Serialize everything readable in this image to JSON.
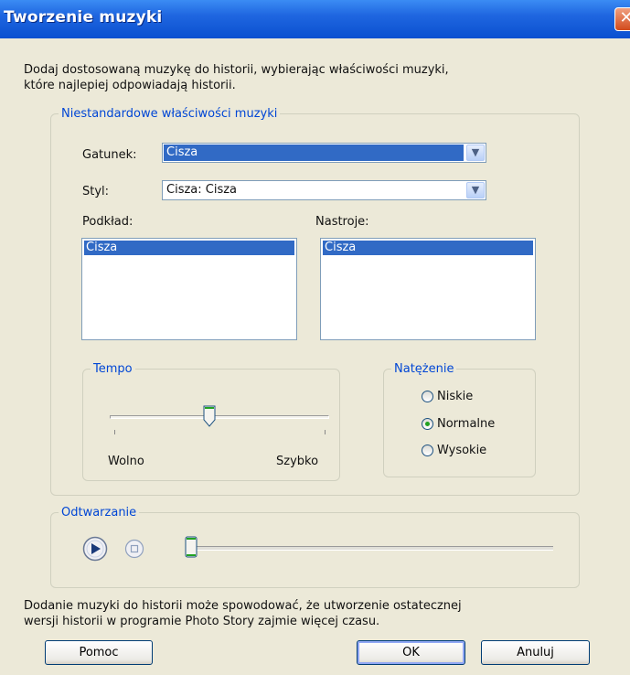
{
  "window": {
    "title": "Tworzenie muzyki",
    "close_glyph": "✕"
  },
  "intro_text_1": "Dodaj dostosowaną muzykę do historii, wybierając właściwości muzyki,",
  "intro_text_2": "które najlepiej odpowiadają historii.",
  "props_group": {
    "legend": "Niestandardowe właściwości muzyki",
    "genre_label": "Gatunek:",
    "genre_value": "Cisza",
    "style_label": "Styl:",
    "style_value": "Cisza: Cisza",
    "bands_label": "Podkład:",
    "bands_items": [
      "Cisza"
    ],
    "moods_label": "Nastroje:",
    "moods_items": [
      "Cisza"
    ]
  },
  "tempo_group": {
    "legend": "Tempo",
    "slow_label": "Wolno",
    "fast_label": "Szybko",
    "level_fraction": 0.45
  },
  "intensity_group": {
    "legend": "Natężenie",
    "options": [
      "Niskie",
      "Normalne",
      "Wysokie"
    ],
    "selected": "Normalne"
  },
  "playback_group": {
    "legend": "Odtwarzanie",
    "position_fraction": 0.0
  },
  "footer_text_1": "Dodanie muzyki do historii może spowodować, że utworzenie ostatecznej",
  "footer_text_2": "wersji historii w programie Photo Story zajmie więcej czasu.",
  "buttons": {
    "help": "Pomoc",
    "ok": "OK",
    "cancel": "Anuluj"
  },
  "icons": {
    "close": "close-icon",
    "play": "play-icon",
    "stop": "stop-icon",
    "dropdown": "chevron-down-icon"
  }
}
